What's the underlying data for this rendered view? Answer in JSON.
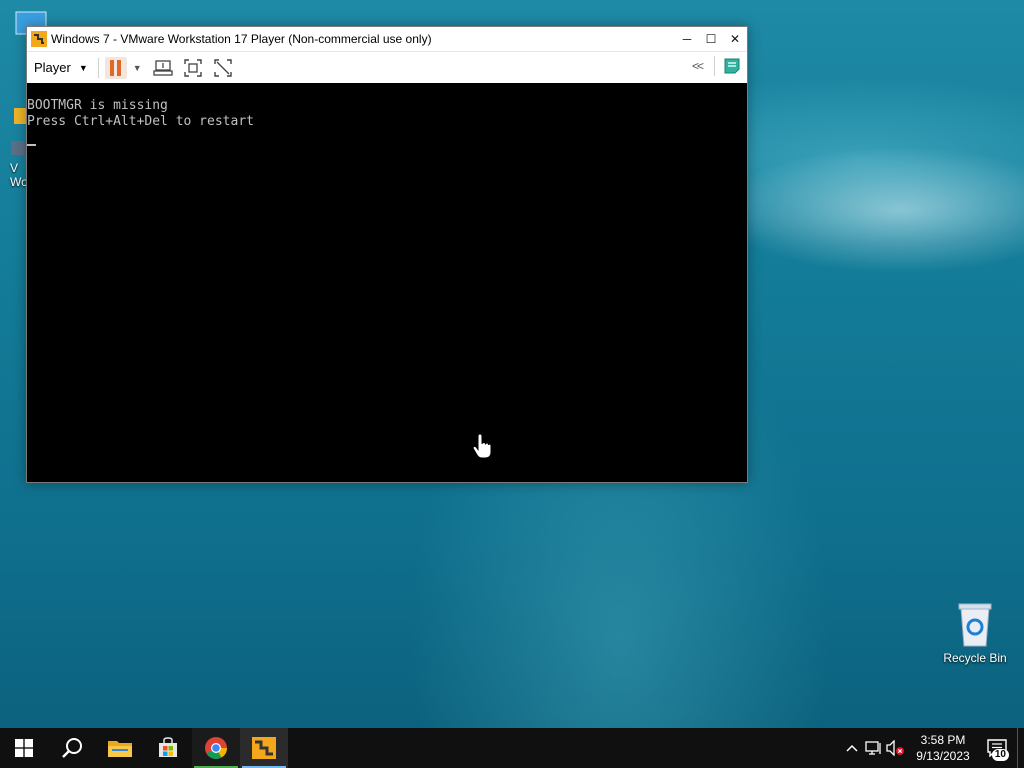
{
  "window": {
    "title": "Windows 7 - VMware Workstation 17 Player (Non-commercial use only)",
    "minimize": "─",
    "maximize": "☐",
    "close": "✕"
  },
  "toolbar": {
    "player_menu": "Player",
    "caret": "▼",
    "collapse": "<<"
  },
  "console": {
    "lines": [
      "BOOTMGR is missing",
      "Press Ctrl+Alt+Del to restart"
    ]
  },
  "desktop": {
    "recycle_bin_label": "Recycle Bin"
  },
  "taskbar": {
    "items": [
      "start",
      "search",
      "file-explorer",
      "microsoft-store",
      "chrome",
      "vmware-player"
    ],
    "active_item": "vmware-player",
    "clock_time": "3:58 PM",
    "clock_date": "9/13/2023",
    "notification_count": "10"
  },
  "colors": {
    "pause_orange": "#e0682b",
    "console_text": "#c0c0c0",
    "taskbar_bg": "#101010"
  }
}
